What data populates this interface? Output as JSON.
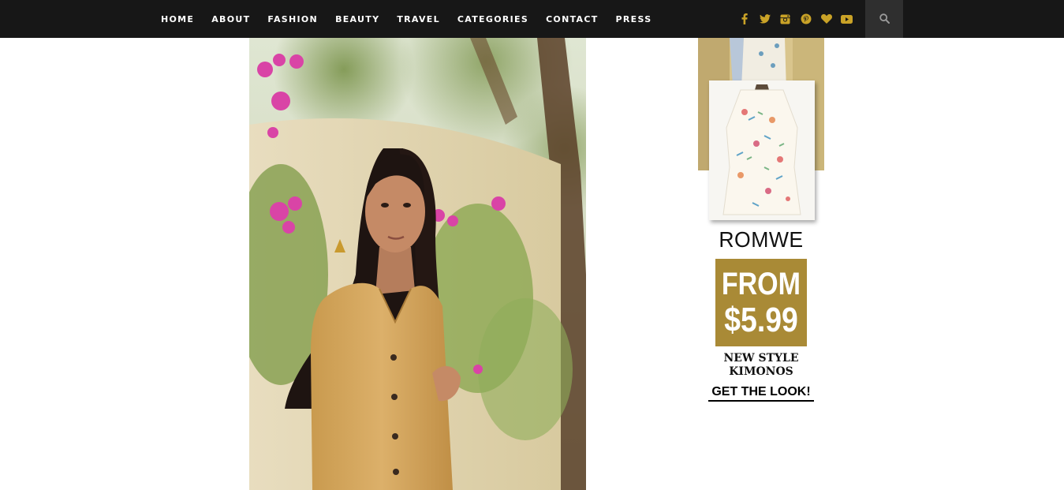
{
  "nav": {
    "items": [
      {
        "label": "HOME"
      },
      {
        "label": "ABOUT"
      },
      {
        "label": "FASHION"
      },
      {
        "label": "BEAUTY"
      },
      {
        "label": "TRAVEL"
      },
      {
        "label": "CATEGORIES"
      },
      {
        "label": "CONTACT"
      },
      {
        "label": "PRESS"
      }
    ]
  },
  "social": {
    "icons": [
      "facebook-icon",
      "twitter-icon",
      "instagram-icon",
      "pinterest-icon",
      "heart-icon",
      "youtube-icon"
    ],
    "color": "#c9a227"
  },
  "search": {
    "icon": "search-icon"
  },
  "ad": {
    "brand": "ROMWE",
    "price_line1": "FROM",
    "price_line2": "$5.99",
    "sub_line1": "NEW STYLE",
    "sub_line2": "KIMONOS",
    "cta": "GET THE LOOK!",
    "accent": "#a98a36"
  }
}
